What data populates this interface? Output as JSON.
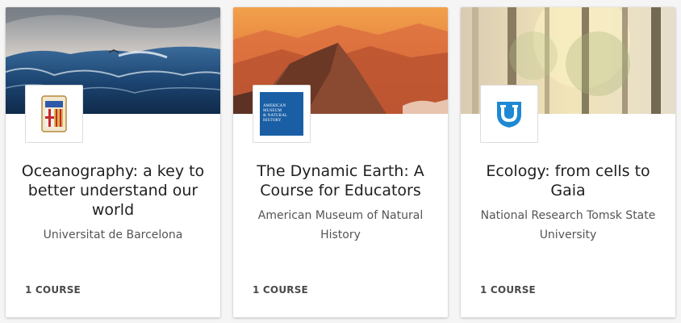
{
  "cards": [
    {
      "title_lines": [
        "Oceanography: a key to",
        "better understand our",
        "world"
      ],
      "org_lines": [
        "Universitat de Barcelona"
      ],
      "count": "1 COURSE",
      "logo_icon": "university-crest-icon",
      "colors": {
        "ocean": "#1f4a78",
        "sky": "#c9c3bc"
      }
    },
    {
      "title_lines": [
        "The Dynamic Earth: A",
        "Course for Educators"
      ],
      "org_lines": [
        "American Museum of Natural",
        "History"
      ],
      "count": "1 COURSE",
      "logo_icon": "museum-logo-icon",
      "logo_text": [
        "AMERICAN MUSEUM",
        "& NATURAL HISTORY"
      ],
      "colors": {
        "sunset": "#e8893a",
        "logo_bg": "#1a5fa5"
      }
    },
    {
      "title_lines": [
        "Ecology: from cells to",
        "Gaia"
      ],
      "org_lines": [
        "National Research Tomsk State",
        "University"
      ],
      "count": "1 COURSE",
      "logo_icon": "u-shield-icon",
      "colors": {
        "forest": "#c9b58a",
        "logo_blue": "#1e88d4"
      }
    }
  ]
}
